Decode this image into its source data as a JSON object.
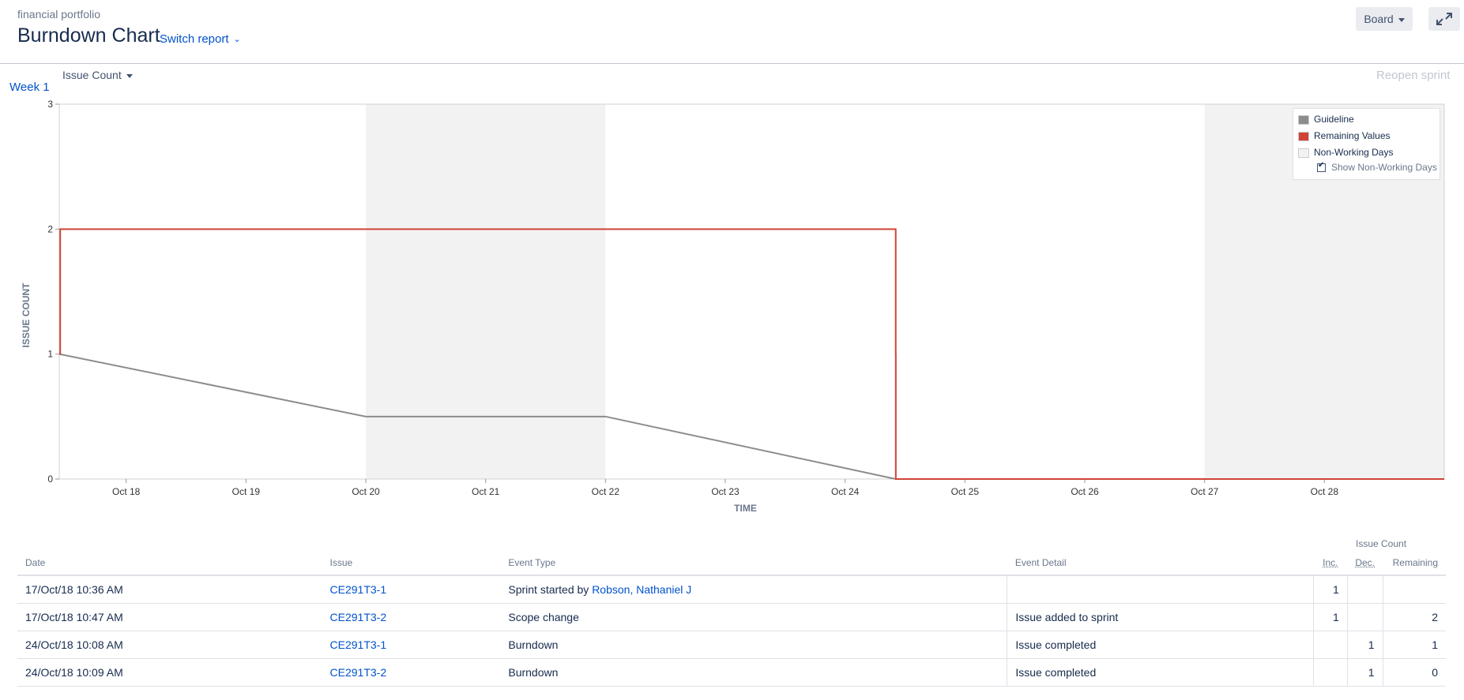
{
  "header": {
    "project": "financial portfolio",
    "title": "Burndown Chart",
    "switch_report": "Switch report",
    "board_button": "Board",
    "expand_icon": "expand-icon"
  },
  "controls": {
    "statistic": "Issue Count",
    "week_link": "Week 1",
    "reopen_sprint": "Reopen sprint"
  },
  "legend": {
    "guideline": "Guideline",
    "remaining": "Remaining Values",
    "non_working": "Non-Working Days",
    "show_non_working": "Show Non-Working Days"
  },
  "chart_data": {
    "type": "line",
    "xlabel": "TIME",
    "ylabel": "ISSUE COUNT",
    "ylim": [
      0,
      3
    ],
    "yticks": [
      0,
      1,
      2,
      3
    ],
    "xlim": [
      "2018-10-17 10:36",
      "2018-10-28 24:00"
    ],
    "xticks": [
      "Oct 18",
      "Oct 19",
      "Oct 20",
      "Oct 21",
      "Oct 22",
      "Oct 23",
      "Oct 24",
      "Oct 25",
      "Oct 26",
      "Oct 27",
      "Oct 28"
    ],
    "non_working_days": [
      [
        "Oct 20",
        "Oct 22"
      ],
      [
        "Oct 27",
        "Oct 29"
      ]
    ],
    "series": [
      {
        "name": "Guideline",
        "color": "#8c8c8c",
        "points": [
          [
            "Oct 17 10:36",
            1
          ],
          [
            "Oct 20",
            0.5
          ],
          [
            "Oct 22",
            0.5
          ],
          [
            "Oct 24 10:08",
            0
          ]
        ]
      },
      {
        "name": "Remaining Values",
        "color": "#d04437",
        "step": true,
        "points": [
          [
            "Oct 17 10:36",
            1
          ],
          [
            "Oct 17 10:47",
            2
          ],
          [
            "Oct 24 10:08",
            1
          ],
          [
            "Oct 24 10:09",
            0
          ],
          [
            "Oct 28 24:00",
            0
          ]
        ]
      }
    ]
  },
  "table": {
    "group_header": "Issue Count",
    "headers": [
      "Date",
      "Issue",
      "Event Type",
      "Event Detail",
      "Inc.",
      "Dec.",
      "Remaining"
    ],
    "rows": [
      {
        "date": "17/Oct/18 10:36 AM",
        "issue": "CE291T3-1",
        "type": "Sprint started by ",
        "type_link": "Robson, Nathaniel J",
        "detail": "",
        "inc": "1",
        "dec": "",
        "remaining": ""
      },
      {
        "date": "17/Oct/18 10:47 AM",
        "issue": "CE291T3-2",
        "type": "Scope change",
        "type_link": "",
        "detail": "Issue added to sprint",
        "inc": "1",
        "dec": "",
        "remaining": "2"
      },
      {
        "date": "24/Oct/18 10:08 AM",
        "issue": "CE291T3-1",
        "type": "Burndown",
        "type_link": "",
        "detail": "Issue completed",
        "inc": "",
        "dec": "1",
        "remaining": "1"
      },
      {
        "date": "24/Oct/18 10:09 AM",
        "issue": "CE291T3-2",
        "type": "Burndown",
        "type_link": "",
        "detail": "Issue completed",
        "inc": "",
        "dec": "1",
        "remaining": "0"
      }
    ]
  }
}
